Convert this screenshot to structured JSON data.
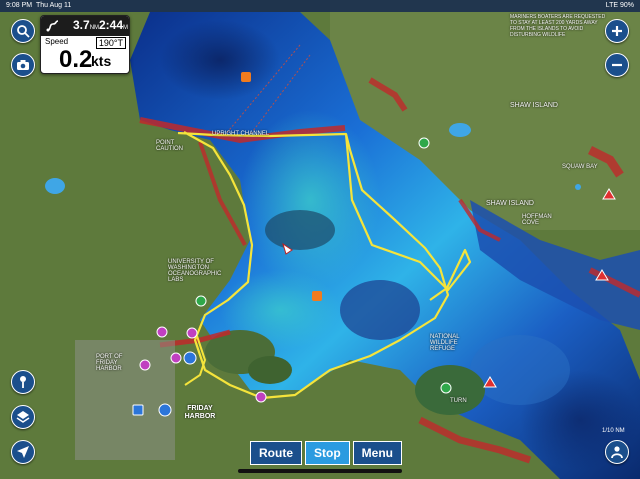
{
  "status_bar": {
    "time": "9:08 PM",
    "date": "Thu Aug 11",
    "signal": "LTE",
    "battery": "90%"
  },
  "info_panel": {
    "distance_value": "3.7",
    "distance_unit": "NM",
    "eta_value": "2:44",
    "eta_unit": "M",
    "speed_label": "Speed",
    "heading": "190°T",
    "speed_value": "0.2",
    "speed_unit": "kts"
  },
  "bottom_bar": {
    "route_label": "Route",
    "stop_label": "Stop",
    "menu_label": "Menu"
  },
  "map_labels": {
    "shaw_island": "SHAW ISLAND",
    "shaw_island_2": "SHAW ISLAND",
    "squaw_bay": "SQUAW BAY",
    "hoffman_cove": "HOFFMAN COVE",
    "point_caution": "POINT CAUTION",
    "university_lab": "UNIVERSITY OF WASHINGTON OCEANOGRAPHIC LABS",
    "port_of_friday_harbor": "PORT OF FRIDAY HARBOR",
    "friday_harbor": "FRIDAY HARBOR",
    "national_wildlife_refuge": "NATIONAL WILDLIFE REFUGE",
    "turn_island": "TURN",
    "upright_channel": "UPRIGHT CHANNEL",
    "notice": "MARINERS BOATERS ARE REQUESTED TO STAY AT LEAST 200 YARDS AWAY FROM THE ISLANDS TO AVOID DISTURBING WILDLIFE"
  },
  "scale": "1/10 NM"
}
